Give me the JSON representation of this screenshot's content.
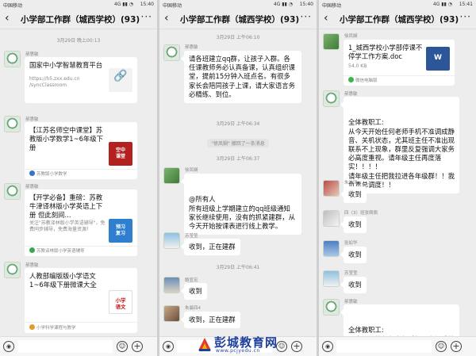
{
  "status": {
    "carrier": "中国移动",
    "net": "4G ▮▮ ◔",
    "times": [
      "15:40",
      "15:40",
      "15:41"
    ]
  },
  "header": {
    "title": "小学部工作群（城西学校）(93)",
    "back": "‹",
    "more": "···"
  },
  "screen1": {
    "ts1": "3月29日 晚上00:13",
    "sender1": "郝惠敏",
    "card1": {
      "title": "国家中小学智慧教育平台",
      "desc": "https://h5.zxx.edu.cn\n/syncClassroom",
      "thumb": "🔗"
    },
    "sender2": "郝惠敏",
    "card2": {
      "title": "【江苏名师空中课堂】苏教版小学数学1~6年级下册",
      "thumb": "空中\n课堂",
      "footer": "苏教版小学数学"
    },
    "sender3": "郝惠敏",
    "card3": {
      "title": "【开学必备】重磅：苏教牛津译林版小学英语上下册 但此刻间...",
      "desc": "关注\"苏教译林版小学英语辅导\"，免费同步辅导，免费海量资源！",
      "thumb": "预习\n复习",
      "footer": "苏教译林版小学英语辅导"
    },
    "sender4": "郝惠敏",
    "card4": {
      "title": "人教部编版版小学语文1~6年级下册微课大全",
      "thumb": "小学\n语文",
      "footer": "小学科学课程与教学"
    }
  },
  "screen2": {
    "ts1": "3月29日 上午06:10",
    "sender1": "郝惠敏",
    "msg1": "请各班建立qq群，让孩子入群。各任课教师务必认真备课，认真组织课堂，提前15分钟入班点名。有很多家长会陪同孩子上课，请大家语言务必精练、到位。",
    "ts2": "3月29日 上午06:34",
    "sys": "\"徐凤娴\" 撤回了一条消息",
    "ts3": "3月29日 上午06:37",
    "sender2": "徐凤娴",
    "msg2": "@所有人\n所有班级上学期建立的qq班级通知家长继续使用，没有的抓紧建群，从今天开始按课表进行线上教学。",
    "sender3": "苏莹莹",
    "msg3": "收到，正在建群",
    "ts4": "3月29日 上午06:41",
    "sender4": "鲍宣宏",
    "msg4": "收到",
    "sender5": "朱晨四4",
    "msg5": "收到，正在建群"
  },
  "screen3": {
    "sender1": "徐凤娴",
    "file": {
      "title": "1_城西学校小学部停课不停学工作方案.doc",
      "size": "54.0 KB",
      "thumb": "W",
      "footer": "微信电脑版"
    },
    "sender2": "郝惠敏",
    "msg1": "全体教职工:\n    从今天开始任何老师手机不准调成静音、关机状态，尤其班主任不准出现联系不上现象，群里反复强调大家务必高度重视。请年级主任再度落实！！！！\n    请年级主任把我拉进各年级群！！我负责总调度！！",
    "sender3": "朱晨四",
    "msg2": "收到",
    "sender4": "四（3）班张佩佩",
    "msg3": "收到",
    "sender5": "张如华",
    "msg4": "收到",
    "sender6": "苏莹莹",
    "msg5": "收到",
    "sender7": "郝惠敏",
    "msg6": "全体教职工:\n    从今天开始任何老师手机不准调成静音、关机状态，尤其班主任"
  },
  "bottom": {
    "voice": "◉",
    "emoji": "☺",
    "plus": "+",
    "hint": "⊙"
  },
  "watermark": {
    "brand": "彭城教育网",
    "url": "www.pcjyedu.cn"
  },
  "colors": {
    "bg": "#ededed",
    "bubble": "#ffffff",
    "brand": "#1e3f9e"
  }
}
